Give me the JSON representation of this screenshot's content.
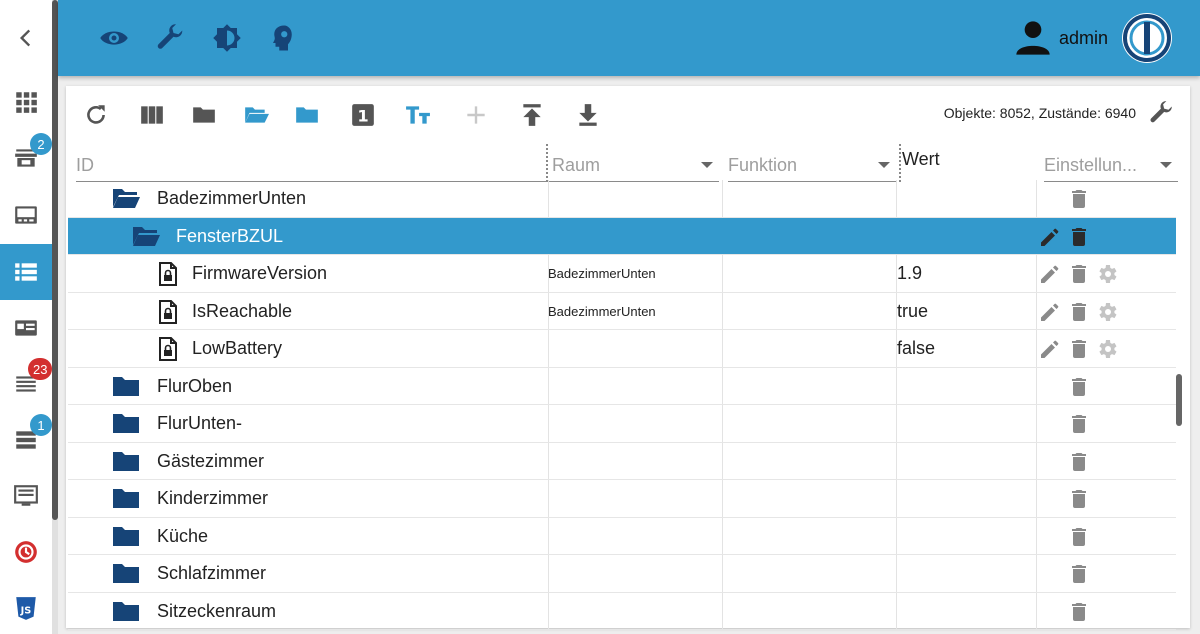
{
  "sidebar": {
    "items": [
      {
        "name": "back",
        "icon": "chevron-left-icon"
      },
      {
        "name": "intro",
        "icon": "apps-grid-icon"
      },
      {
        "name": "adapters",
        "icon": "store-icon",
        "badge": "2",
        "badge_color": "#3399cc"
      },
      {
        "name": "instances",
        "icon": "instances-icon"
      },
      {
        "name": "objects",
        "icon": "list-icon",
        "active": true
      },
      {
        "name": "enums",
        "icon": "enums-icon"
      },
      {
        "name": "logs",
        "icon": "logs-icon",
        "badge": "23",
        "badge_color": "#d32f2f"
      },
      {
        "name": "hosts",
        "icon": "hosts-icon",
        "badge": "1",
        "badge_color": "#3399cc"
      },
      {
        "name": "events",
        "icon": "events-icon"
      },
      {
        "name": "backitup",
        "icon": "backup-icon"
      },
      {
        "name": "scripts",
        "icon": "javascript-icon"
      }
    ]
  },
  "header": {
    "icons": [
      "eye-icon",
      "wrench-icon",
      "brightness-icon",
      "expert-head-icon"
    ],
    "user_name": "admin"
  },
  "toolbar": {
    "icons": [
      "refresh-icon",
      "columns-icon",
      "folder-closed-icon",
      "folder-open-icon",
      "folder-icon",
      "number-one-icon",
      "text-size-icon",
      "add-icon",
      "upload-icon",
      "download-icon"
    ],
    "objects_status": "Objekte: 8052, Zustände: 6940"
  },
  "columns": {
    "id": "ID",
    "room": "Raum",
    "function": "Funktion",
    "value": "Wert",
    "settings": "Einstellun..."
  },
  "rows": [
    {
      "label": "BadezimmerUnten",
      "type": "folder-open",
      "indent": 0,
      "room": "",
      "value": "",
      "actions": [
        "delete"
      ],
      "selected": false
    },
    {
      "label": "FensterBZUL",
      "type": "folder-open",
      "indent": 1,
      "room": "",
      "value": "",
      "actions": [
        "edit",
        "delete"
      ],
      "selected": true
    },
    {
      "label": "FirmwareVersion",
      "type": "state",
      "indent": 2,
      "room": "BadezimmerUnten",
      "value": "1.9",
      "actions": [
        "edit",
        "delete",
        "settings"
      ],
      "selected": false
    },
    {
      "label": "IsReachable",
      "type": "state",
      "indent": 2,
      "room": "BadezimmerUnten",
      "value": "true",
      "actions": [
        "edit",
        "delete",
        "settings"
      ],
      "selected": false
    },
    {
      "label": "LowBattery",
      "type": "state",
      "indent": 2,
      "room": "",
      "value": "false",
      "actions": [
        "edit",
        "delete",
        "settings"
      ],
      "selected": false
    },
    {
      "label": "FlurOben",
      "type": "folder",
      "indent": 0,
      "room": "",
      "value": "",
      "actions": [
        "delete"
      ],
      "selected": false
    },
    {
      "label": "FlurUnten-",
      "type": "folder",
      "indent": 0,
      "room": "",
      "value": "",
      "actions": [
        "delete"
      ],
      "selected": false
    },
    {
      "label": "Gästezimmer",
      "type": "folder",
      "indent": 0,
      "room": "",
      "value": "",
      "actions": [
        "delete"
      ],
      "selected": false
    },
    {
      "label": "Kinderzimmer",
      "type": "folder",
      "indent": 0,
      "room": "",
      "value": "",
      "actions": [
        "delete"
      ],
      "selected": false
    },
    {
      "label": "Küche",
      "type": "folder",
      "indent": 0,
      "room": "",
      "value": "",
      "actions": [
        "delete"
      ],
      "selected": false
    },
    {
      "label": "Schlafzimmer",
      "type": "folder",
      "indent": 0,
      "room": "",
      "value": "",
      "actions": [
        "delete"
      ],
      "selected": false
    },
    {
      "label": "Sitzeckenraum",
      "type": "folder",
      "indent": 0,
      "room": "",
      "value": "",
      "actions": [
        "delete"
      ],
      "selected": false
    }
  ],
  "colors": {
    "accent": "#3399cc",
    "folder": "#164477",
    "badge_red": "#d32f2f"
  }
}
